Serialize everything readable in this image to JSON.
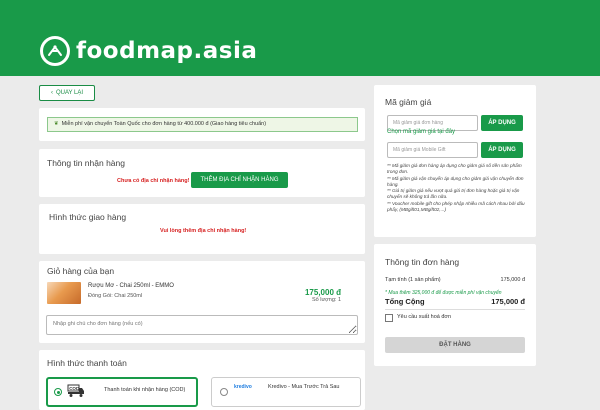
{
  "brand": {
    "name": "foodmap.asia"
  },
  "nav": {
    "back_label": "QUAY LẠI"
  },
  "shipping_banner": {
    "text": "Miễn phí vận chuyển Toàn Quốc cho đơn hàng từ 400.000 đ (Giao hàng tiêu chuẩn)"
  },
  "receiver": {
    "title": "Thông tin nhận hàng",
    "warning": "Chưa có địa chỉ nhận hàng!",
    "add_button": "THÊM ĐỊA CHỈ NHẬN HÀNG"
  },
  "delivery": {
    "title": "Hình thức giao hàng",
    "warning": "Vui lòng thêm địa chỉ nhận hàng!"
  },
  "cart": {
    "title": "Giỏ hàng của bạn",
    "items": [
      {
        "name": "Rượu Mơ - Chai 250ml - EMMO",
        "variant": "Đóng Gói: Chai 250ml",
        "price": "175,000 đ",
        "quantity": "Số lượng: 1"
      }
    ],
    "note_placeholder": "Nhập ghi chú cho đơn hàng (nếu có)"
  },
  "payment": {
    "title": "Hình thức thanh toán",
    "options": [
      {
        "label": "Thanh toán khi nhận hàng (COD)",
        "icon": "COD",
        "selected": true
      },
      {
        "label": "Kredivo - Mua Trước Trả Sau",
        "icon": "kredivo",
        "selected": false
      }
    ]
  },
  "discount": {
    "title": "Mã giảm giá",
    "order_code_placeholder": "Mã giảm giá đơn hàng",
    "gift_code_placeholder": "Mã giảm giá Mobile Gift",
    "apply_label": "ÁP DỤNG",
    "pick_link": "Chọn mã giảm giá tại đây",
    "notes": [
      "** Mã giảm giá đơn hàng áp dụng cho giảm giá số tiền sản phẩm trong đơn.",
      "** Mã giảm giá vận chuyển áp dụng cho giảm giá vận chuyển đơn hàng.",
      "** Giá trị giảm giá nếu vượt quá giá trị đơn hàng hoặc giá trị vận chuyển sẽ không trả lần nữa.",
      "** Voucher mobile gift cho phép nhập nhiều mã cách nhau bởi dấu phẩy, (MBgift01,MBgift02,...)"
    ]
  },
  "order_summary": {
    "title": "Thông tin đơn hàng",
    "subtotal_label": "Tạm tính (1 sản phẩm)",
    "subtotal_value": "175,000 đ",
    "shipping_note": "* Mua thêm 325,000 đ để được miễn phí vận chuyển",
    "total_label": "Tổng Cộng",
    "total_value": "175,000 đ",
    "invoice_label": "Yêu cầu xuất hoá đơn",
    "submit_label": "ĐẶT HÀNG"
  },
  "colors": {
    "brand_green": "#199a49",
    "warning_red": "#d61f1f"
  }
}
